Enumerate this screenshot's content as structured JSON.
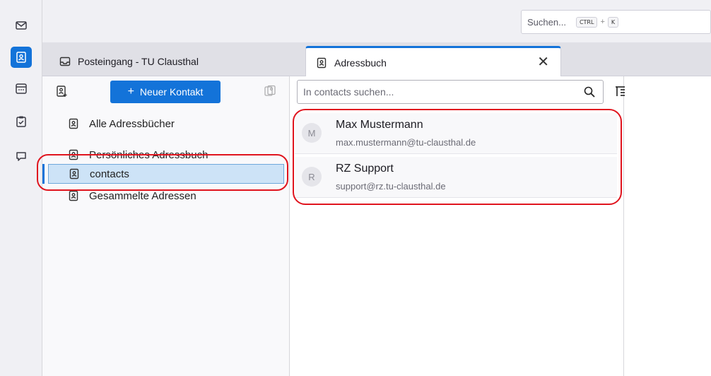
{
  "spaces": {
    "items": [
      {
        "name": "mail",
        "active": false
      },
      {
        "name": "addressbook",
        "active": true
      },
      {
        "name": "calendar",
        "active": false
      },
      {
        "name": "tasks",
        "active": false
      },
      {
        "name": "chat",
        "active": false
      }
    ]
  },
  "global_search": {
    "placeholder": "Suchen...",
    "shortcut_key1": "CTRL",
    "shortcut_plus": "+",
    "shortcut_key2": "K"
  },
  "tabs": [
    {
      "label": "Posteingang - TU Clausthal",
      "active": false
    },
    {
      "label": "Adressbuch",
      "active": true,
      "close": "✕"
    }
  ],
  "sidebar": {
    "new_contact_label": "Neuer Kontakt",
    "new_contact_plus": "+",
    "books": [
      {
        "label": "Alle Adressbücher"
      },
      {
        "label": "Persönliches Adressbuch"
      },
      {
        "label": "contacts",
        "selected": true
      },
      {
        "label": "Gesammelte Adressen"
      }
    ]
  },
  "contact_list": {
    "search_placeholder": "In contacts suchen...",
    "contacts": [
      {
        "initial": "M",
        "name": "Max Mustermann",
        "email": "max.mustermann@tu-clausthal.de"
      },
      {
        "initial": "R",
        "name": "RZ Support",
        "email": "support@rz.tu-clausthal.de"
      }
    ],
    "scroll_up": "^"
  },
  "colors": {
    "accent": "#1373d9",
    "annotation": "#e0141e",
    "selection": "#cde3f7"
  }
}
